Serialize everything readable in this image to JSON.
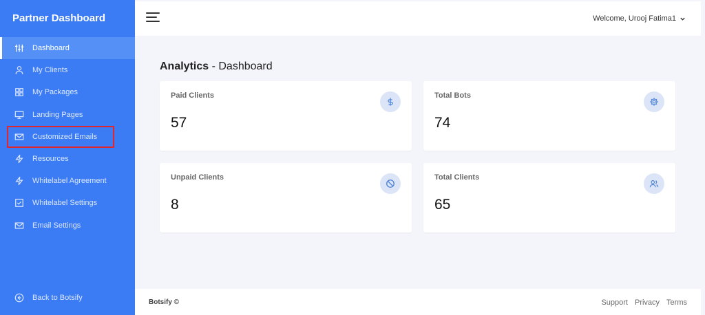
{
  "sidebar": {
    "brand": "Partner Dashboard",
    "items": [
      {
        "label": "Dashboard",
        "icon": "sliders-icon"
      },
      {
        "label": "My Clients",
        "icon": "user-icon"
      },
      {
        "label": "My Packages",
        "icon": "grid-icon"
      },
      {
        "label": "Landing Pages",
        "icon": "monitor-icon"
      },
      {
        "label": "Customized Emails",
        "icon": "mail-icon"
      },
      {
        "label": "Resources",
        "icon": "lightning-icon"
      },
      {
        "label": "Whitelabel Agreement",
        "icon": "lightning-icon"
      },
      {
        "label": "Whitelabel Settings",
        "icon": "checkbox-icon"
      },
      {
        "label": "Email Settings",
        "icon": "mail-icon"
      }
    ],
    "back_label": "Back to Botsify",
    "active_item": "Dashboard",
    "highlighted_item": "Customized Emails"
  },
  "topbar": {
    "welcome": "Welcome, Urooj Fatima1"
  },
  "page": {
    "heading_bold": "Analytics",
    "heading_rest": " - Dashboard"
  },
  "cards": [
    {
      "label": "Paid Clients",
      "value": "57",
      "icon": "dollar-icon"
    },
    {
      "label": "Total Bots",
      "value": "74",
      "icon": "gear-icon"
    },
    {
      "label": "Unpaid Clients",
      "value": "8",
      "icon": "ban-icon"
    },
    {
      "label": "Total Clients",
      "value": "65",
      "icon": "users-icon"
    }
  ],
  "footer": {
    "copyright": "Botsify ©",
    "links": [
      "Support",
      "Privacy",
      "Terms"
    ]
  },
  "colors": {
    "sidebar": "#3b7cf5",
    "highlight_box": "#e3262e",
    "badge_bg": "#dbe5f7",
    "icon_blue": "#4a7fd6"
  }
}
